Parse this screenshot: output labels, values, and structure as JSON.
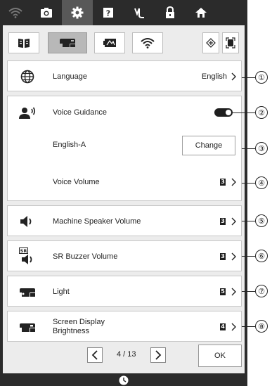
{
  "topbar": {
    "icons": [
      "wifi-icon",
      "camera-icon",
      "settings-icon",
      "help-icon",
      "stitch-icon",
      "lock-icon",
      "home-icon"
    ],
    "active_index": 2
  },
  "category_tabs": [
    "sewing-settings-tab",
    "embroidery-settings-tab",
    "machine-settings-tab",
    "network-settings-tab"
  ],
  "active_tab_index": 1,
  "settings": {
    "language": {
      "label": "Language",
      "value": "English"
    },
    "voice_guidance": {
      "label": "Voice Guidance",
      "enabled": true
    },
    "voice_type": {
      "label": "English-A",
      "button": "Change"
    },
    "voice_volume": {
      "label": "Voice Volume",
      "level": "3"
    },
    "machine_speaker_volume": {
      "label": "Machine Speaker Volume",
      "level": "3"
    },
    "sr_buzzer_volume": {
      "label": "SR Buzzer Volume",
      "level": "3",
      "icon_text": "SR"
    },
    "light": {
      "label": "Light",
      "level": "5"
    },
    "screen_brightness": {
      "label_line1": "Screen Display",
      "label_line2": "Brightness",
      "level": "4"
    }
  },
  "pager": {
    "indicator": "4 / 13"
  },
  "ok_label": "OK",
  "callouts": [
    "①",
    "②",
    "③",
    "④",
    "⑤",
    "⑥",
    "⑦",
    "⑧"
  ]
}
